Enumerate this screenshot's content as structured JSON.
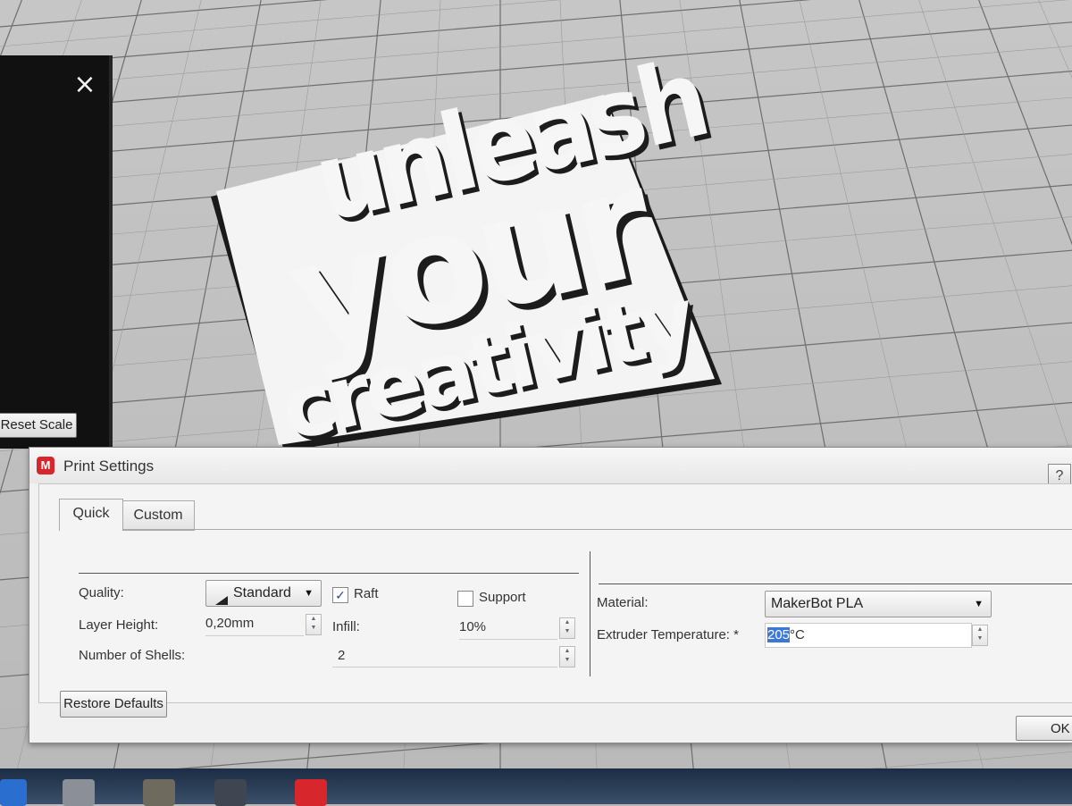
{
  "side_panel": {
    "close_glyph": "×",
    "reset_scale_label": "Reset Scale"
  },
  "model": {
    "line1": "unleash",
    "line2": "your",
    "line3": "creativity"
  },
  "dialog": {
    "title": "Print Settings",
    "help_glyph": "?",
    "tabs": [
      {
        "label": "Quick",
        "active": true
      },
      {
        "label": "Custom",
        "active": false
      }
    ],
    "quality_label": "Quality:",
    "quality_value": "Standard",
    "raft_label": "Raft",
    "raft_checked": true,
    "support_label": "Support",
    "support_checked": false,
    "layer_height_label": "Layer Height:",
    "layer_height_value": "0,20mm",
    "infill_label": "Infill:",
    "infill_value": "10%",
    "shells_label": "Number of Shells:",
    "shells_value": "2",
    "material_label": "Material:",
    "material_value": "MakerBot PLA",
    "extruder_label": "Extruder Temperature: *",
    "extruder_value": "205",
    "extruder_unit": "°C",
    "restore_defaults_label": "Restore Defaults",
    "ok_label": "OK"
  },
  "taskbar": {
    "icons": [
      "settings-icon",
      "generic-app-icon",
      "gimp-icon",
      "inkscape-icon",
      "makerbot-icon"
    ]
  },
  "colors": {
    "grid_bg": "#c3c3c3",
    "panel_dark": "#111111",
    "accent_red": "#d7262c",
    "selection_blue": "#3b78d8"
  }
}
